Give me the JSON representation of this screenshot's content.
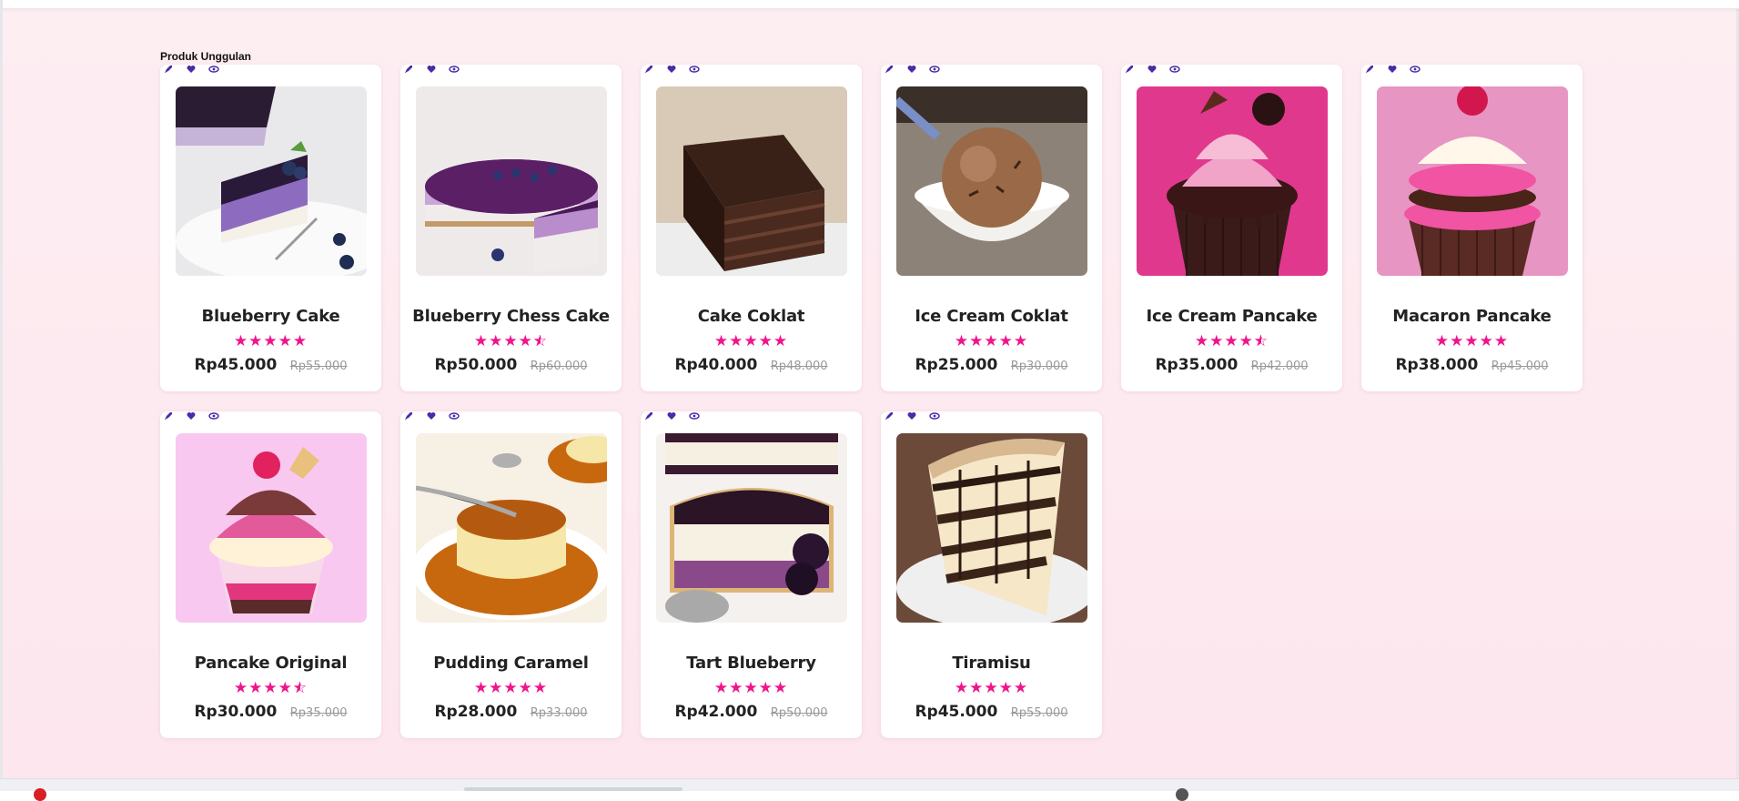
{
  "section": {
    "title": "Produk Unggulan"
  },
  "colors": {
    "accent": "#f0148c",
    "icon": "#4b2aa8"
  },
  "products": [
    {
      "name": "Blueberry Cake",
      "rating": 5,
      "price": "Rp45.000",
      "old_price": "Rp55.000",
      "image": "blueberry-cheesecake-slice"
    },
    {
      "name": "Blueberry Chess Cake",
      "rating": 4.5,
      "price": "Rp50.000",
      "old_price": "Rp60.000",
      "image": "blueberry-whole-cheesecake"
    },
    {
      "name": "Cake Coklat",
      "rating": 5,
      "price": "Rp40.000",
      "old_price": "Rp48.000",
      "image": "chocolate-layer-cake"
    },
    {
      "name": "Ice Cream Coklat",
      "rating": 5,
      "price": "Rp25.000",
      "old_price": "Rp30.000",
      "image": "chocolate-ice-cream-bowl"
    },
    {
      "name": "Ice Cream Pancake",
      "rating": 4.5,
      "price": "Rp35.000",
      "old_price": "Rp42.000",
      "image": "chocolate-cupcake-pink"
    },
    {
      "name": "Macaron Pancake",
      "rating": 5,
      "price": "Rp38.000",
      "old_price": "Rp45.000",
      "image": "macaron-cupcake"
    },
    {
      "name": "Pancake Original",
      "rating": 4.5,
      "price": "Rp30.000",
      "old_price": "Rp35.000",
      "image": "pink-cupcake"
    },
    {
      "name": "Pudding Caramel",
      "rating": 5,
      "price": "Rp28.000",
      "old_price": "Rp33.000",
      "image": "caramel-pudding"
    },
    {
      "name": "Tart Blueberry",
      "rating": 5,
      "price": "Rp42.000",
      "old_price": "Rp50.000",
      "image": "blueberry-tart"
    },
    {
      "name": "Tiramisu",
      "rating": 5,
      "price": "Rp45.000",
      "old_price": "Rp55.000",
      "image": "tiramisu-slice"
    }
  ]
}
